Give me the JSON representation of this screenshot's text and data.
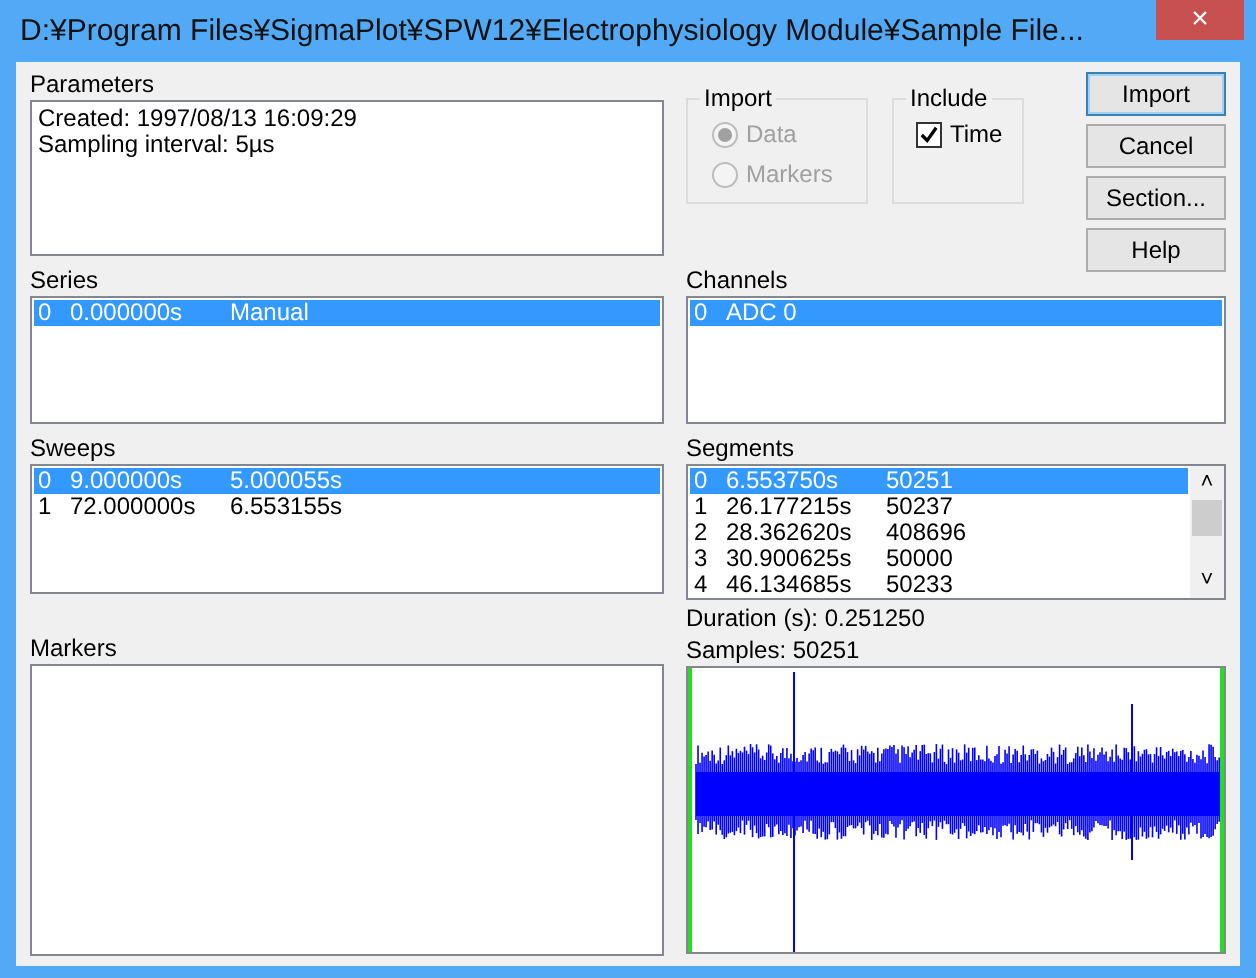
{
  "window": {
    "title": "D:¥Program Files¥SigmaPlot¥SPW12¥Electrophysiology Module¥Sample File...",
    "close": "×"
  },
  "parameters": {
    "label": "Parameters",
    "lines": [
      "Created: 1997/08/13 16:09:29",
      "Sampling interval: 5µs"
    ]
  },
  "import_group": {
    "label": "Import",
    "disabled": true,
    "options": [
      {
        "label": "Data",
        "selected": true
      },
      {
        "label": "Markers",
        "selected": false
      }
    ]
  },
  "include_group": {
    "label": "Include",
    "options": [
      {
        "label": "Time",
        "checked": true
      }
    ]
  },
  "buttons": [
    {
      "label": "Import",
      "default": true
    },
    {
      "label": "Cancel",
      "default": false
    },
    {
      "label": "Section...",
      "default": false
    },
    {
      "label": "Help",
      "default": false
    }
  ],
  "series": {
    "label": "Series",
    "rows": [
      {
        "cells": [
          "0",
          "0.000000s",
          "Manual"
        ],
        "selected": true
      }
    ]
  },
  "channels": {
    "label": "Channels",
    "rows": [
      {
        "cells": [
          "0",
          "ADC 0"
        ],
        "selected": true
      }
    ]
  },
  "sweeps": {
    "label": "Sweeps",
    "rows": [
      {
        "cells": [
          "0",
          "9.000000s",
          "5.000055s"
        ],
        "selected": true
      },
      {
        "cells": [
          "1",
          "72.000000s",
          "6.553155s"
        ],
        "selected": false
      }
    ]
  },
  "segments": {
    "label": "Segments",
    "scroll_up": "˄",
    "scroll_down": "˅",
    "rows": [
      {
        "cells": [
          "0",
          "6.553750s",
          "50251"
        ],
        "selected": true
      },
      {
        "cells": [
          "1",
          "26.177215s",
          "50237"
        ],
        "selected": false
      },
      {
        "cells": [
          "2",
          "28.362620s",
          "408696"
        ],
        "selected": false
      },
      {
        "cells": [
          "3",
          "30.900625s",
          "50000"
        ],
        "selected": false
      },
      {
        "cells": [
          "4",
          "46.134685s",
          "50233"
        ],
        "selected": false
      }
    ]
  },
  "markers": {
    "label": "Markers"
  },
  "duration": "Duration (s): 0.251250",
  "samples": "Samples: 50251"
}
